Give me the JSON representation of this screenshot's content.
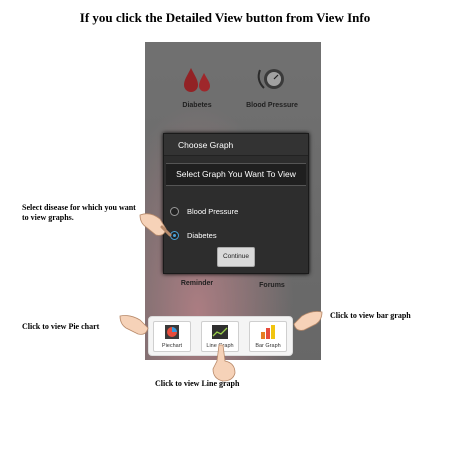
{
  "page_title": "If you click the Detailed View button from View Info",
  "app": {
    "tiles": [
      {
        "label": "Diabetes",
        "icon": "blood-drop-icon"
      },
      {
        "label": "Blood Pressure",
        "icon": "blood-pressure-monitor-icon"
      },
      {
        "label": "Reminder",
        "icon": "reminder-icon"
      },
      {
        "label": "Forums",
        "icon": "forums-icon"
      }
    ]
  },
  "dialog": {
    "title": "Choose Graph",
    "subtitle": "Select Graph You Want To View",
    "options": [
      {
        "label": "Blood Pressure",
        "selected": false
      },
      {
        "label": "Diabetes",
        "selected": true
      }
    ],
    "continue_label": "Continue"
  },
  "graph_bar": {
    "buttons": [
      {
        "label": "Piechart",
        "icon": "pie-chart-icon"
      },
      {
        "label": "Line Graph",
        "icon": "line-graph-icon"
      },
      {
        "label": "Bar Graph",
        "icon": "bar-graph-icon"
      }
    ]
  },
  "annotations": {
    "select_disease": "Select disease for which you want to view graphs.",
    "pie_chart": "Click to view Pie chart",
    "bar_graph": "Click to view bar graph",
    "line_graph": "Click to view Line graph"
  },
  "colors": {
    "accent_radio": "#4aa3d8",
    "dialog_bg": "#2d2d2d",
    "screen_bg": "#8a8a8a"
  }
}
